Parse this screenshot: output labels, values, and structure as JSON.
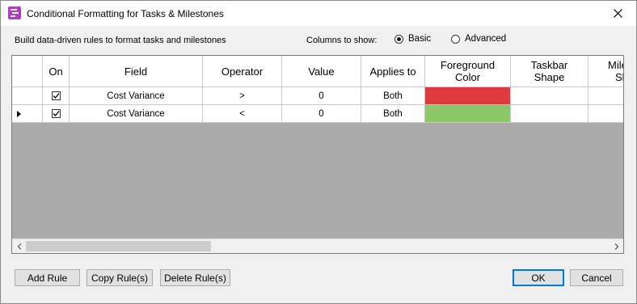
{
  "window": {
    "title": "Conditional Formatting for Tasks & Milestones"
  },
  "description": "Build data-driven rules to format tasks and milestones",
  "columns_to_show": {
    "label": "Columns to show:",
    "options": [
      "Basic",
      "Advanced"
    ],
    "selected": "Basic"
  },
  "grid": {
    "columns": [
      {
        "key": "on",
        "label": "On"
      },
      {
        "key": "field",
        "label": "Field"
      },
      {
        "key": "operator",
        "label": "Operator"
      },
      {
        "key": "value",
        "label": "Value"
      },
      {
        "key": "applies_to",
        "label": "Applies to"
      },
      {
        "key": "foreground",
        "label": "Foreground Color"
      },
      {
        "key": "taskbar_shape",
        "label": "Taskbar Shape"
      },
      {
        "key": "milestone_shape",
        "label": "Milestone Shape"
      }
    ],
    "rows": [
      {
        "on": true,
        "field": "Cost Variance",
        "operator": ">",
        "value": "0",
        "applies_to": "Both",
        "foreground_color": "#e0393e",
        "taskbar_shape": "",
        "milestone_shape": "",
        "current": false
      },
      {
        "on": true,
        "field": "Cost Variance",
        "operator": "<",
        "value": "0",
        "applies_to": "Both",
        "foreground_color": "#8bc867",
        "taskbar_shape": "",
        "milestone_shape": "",
        "current": true
      }
    ]
  },
  "buttons": {
    "add_rule": "Add Rule",
    "copy_rules": "Copy Rule(s)",
    "delete_rules": "Delete Rule(s)",
    "ok": "OK",
    "cancel": "Cancel"
  },
  "colors": {
    "app_icon": "#b13ec2",
    "grid_background": "#ababab",
    "ok_border": "#0078d7"
  },
  "icons": {
    "app": "conditional-formatting-icon",
    "close": "close-icon",
    "check": "checkmark-icon",
    "row_pointer": "row-pointer-icon",
    "scroll_left": "chevron-left-icon",
    "scroll_right": "chevron-right-icon"
  }
}
